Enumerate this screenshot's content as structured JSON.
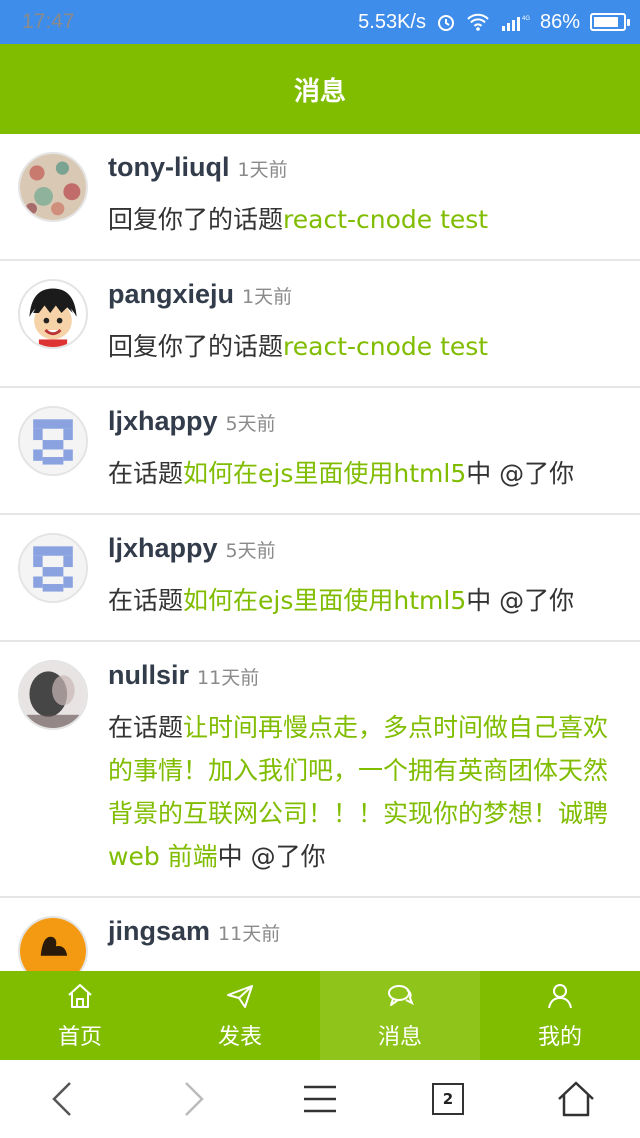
{
  "status": {
    "time": "17:47",
    "speed": "5.53K/s",
    "battery": "86%",
    "battery_level": 0.86
  },
  "header": {
    "title": "消息"
  },
  "messages": [
    {
      "user": "tony-liuql",
      "time": "1天前",
      "prefix": "回复你了的话题",
      "topic": "react-cnode test",
      "suffix": "",
      "avatar_icon": "floral-avatar"
    },
    {
      "user": "pangxieju",
      "time": "1天前",
      "prefix": "回复你了的话题",
      "topic": "react-cnode test",
      "suffix": "",
      "avatar_icon": "cartoon-avatar"
    },
    {
      "user": "ljxhappy",
      "time": "5天前",
      "prefix": "在话题",
      "topic": "如何在ejs里面使用html5",
      "suffix": "中 @了你",
      "avatar_icon": "pixel-avatar"
    },
    {
      "user": "ljxhappy",
      "time": "5天前",
      "prefix": "在话题",
      "topic": "如何在ejs里面使用html5",
      "suffix": "中 @了你",
      "avatar_icon": "pixel-avatar"
    },
    {
      "user": "nullsir",
      "time": "11天前",
      "prefix": "在话题",
      "topic": "让时间再慢点走，多点时间做自己喜欢的事情！加入我们吧，一个拥有英商团体天然背景的互联网公司！！！实现你的梦想！诚聘 web 前端",
      "suffix": "中 @了你",
      "avatar_icon": "photo-avatar"
    },
    {
      "user": "jingsam",
      "time": "11天前",
      "prefix": "",
      "topic": "",
      "suffix": "",
      "avatar_icon": "orange-avatar"
    }
  ],
  "tabs": [
    {
      "label": "首页",
      "icon": "home-icon"
    },
    {
      "label": "发表",
      "icon": "send-icon"
    },
    {
      "label": "消息",
      "icon": "chat-icon"
    },
    {
      "label": "我的",
      "icon": "user-icon"
    }
  ],
  "browser": {
    "tab_count": "2"
  },
  "colors": {
    "accent": "#80bd01",
    "statusbar": "#3f8dea",
    "link": "#80bd01"
  }
}
